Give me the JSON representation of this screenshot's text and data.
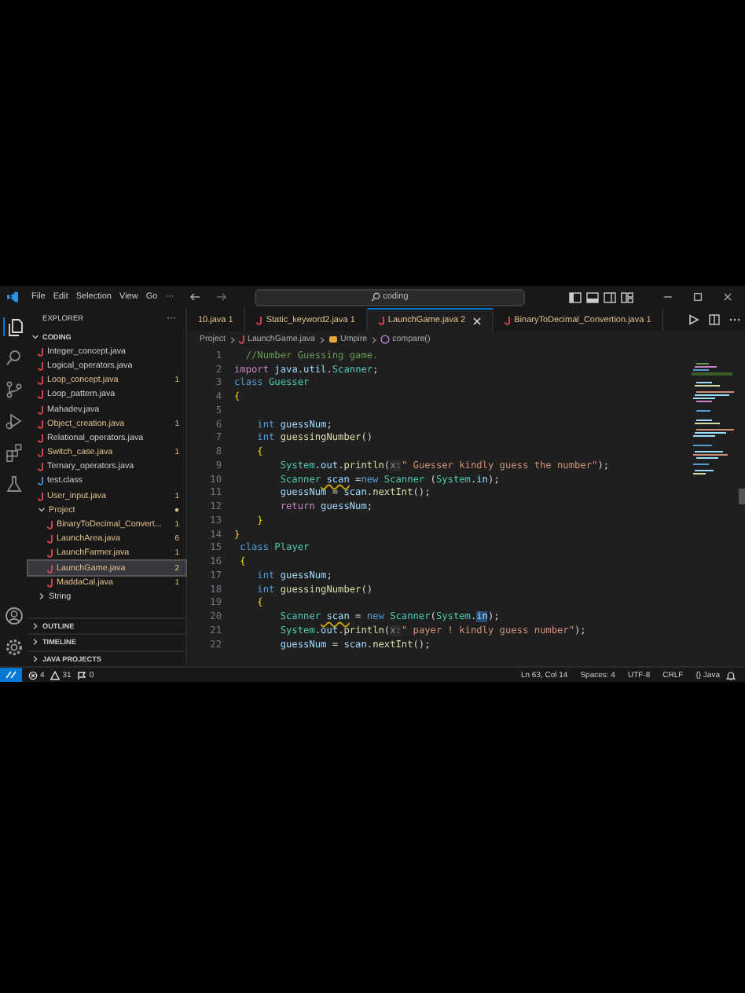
{
  "title_bar": {
    "menu": [
      "File",
      "Edit",
      "Selection",
      "View",
      "Go",
      "···"
    ],
    "search": "coding"
  },
  "activity_bar": {
    "top": [
      {
        "kind": "files",
        "selected": true
      },
      {
        "kind": "search",
        "selected": false
      },
      {
        "kind": "source-control",
        "selected": false
      },
      {
        "kind": "run",
        "selected": false
      },
      {
        "kind": "extensions",
        "selected": false
      },
      {
        "kind": "testing",
        "selected": false
      }
    ],
    "bottom": [
      {
        "kind": "account"
      },
      {
        "kind": "settings"
      }
    ]
  },
  "sidebar": {
    "title": "EXPLORER",
    "more": "···",
    "root": "CODING",
    "items": [
      {
        "kind": "file",
        "label": "Integer_concept.java",
        "modified": false,
        "selected": false
      },
      {
        "kind": "file",
        "label": "Logical_operators.java",
        "modified": false,
        "selected": false
      },
      {
        "kind": "file",
        "label": "Loop_concept.java",
        "badge": "1",
        "modified": true,
        "selected": false
      },
      {
        "kind": "file",
        "label": "Loop_pattern.java",
        "modified": false,
        "selected": false
      },
      {
        "kind": "file",
        "label": "Mahadev.java",
        "modified": false,
        "selected": false
      },
      {
        "kind": "file",
        "label": "Object_creation.java",
        "badge": "1",
        "modified": true,
        "selected": false
      },
      {
        "kind": "file",
        "label": "Relational_operators.java",
        "modified": false,
        "selected": false
      },
      {
        "kind": "file",
        "label": "Switch_case.java",
        "badge": "1",
        "modified": true,
        "selected": false
      },
      {
        "kind": "file",
        "label": "Ternary_operators.java",
        "modified": false,
        "selected": false
      },
      {
        "kind": "class",
        "label": "test.class",
        "modified": false,
        "selected": false
      },
      {
        "kind": "file",
        "label": "User_input.java",
        "badge": "1",
        "modified": true,
        "selected": false
      },
      {
        "kind": "folder",
        "label": "Project",
        "badge": "●",
        "modified": true,
        "selected": false,
        "expanded": true,
        "children": [
          {
            "kind": "file",
            "label": "BinaryToDecimal_Convert...",
            "badge": "1",
            "modified": true,
            "selected": false
          },
          {
            "kind": "file",
            "label": "LaunchArea.java",
            "badge": "6",
            "modified": true,
            "selected": false
          },
          {
            "kind": "file",
            "label": "LaunchFarmer.java",
            "badge": "1",
            "modified": true,
            "selected": false
          },
          {
            "kind": "file",
            "label": "LaunchGame.java",
            "badge": "2",
            "modified": true,
            "selected": true
          },
          {
            "kind": "file",
            "label": "MaddaCal.java",
            "badge": "1",
            "modified": true,
            "selected": false
          }
        ]
      },
      {
        "kind": "folder",
        "label": "String",
        "modified": false,
        "selected": false,
        "expanded": false
      }
    ],
    "panels": [
      "OUTLINE",
      "TIMELINE",
      "JAVA PROJECTS"
    ]
  },
  "tabs": [
    {
      "label": "10.java",
      "badge": "1",
      "selected": false
    },
    {
      "label": "Static_keyword2.java",
      "badge": "1",
      "selected": false
    },
    {
      "label": "LaunchGame.java",
      "badge": "2",
      "selected": true
    },
    {
      "label": "BinaryToDecimal_Convertion.java",
      "badge": "1",
      "selected": false
    }
  ],
  "breadcrumb": [
    {
      "kind": "folder",
      "label": "Project"
    },
    {
      "kind": "file",
      "label": "LaunchGame.java"
    },
    {
      "kind": "class",
      "label": "Umpire"
    },
    {
      "kind": "method",
      "label": "compare()"
    }
  ],
  "code": [
    {
      "num": "1",
      "tokens": [
        {
          "kind": "com",
          "text": "  //Number Guessing game."
        }
      ]
    },
    {
      "num": "2",
      "tokens": [
        {
          "kind": "ctl",
          "text": "import"
        },
        {
          "kind": "var",
          "text": " java"
        },
        {
          "kind": "p",
          "text": "."
        },
        {
          "kind": "var",
          "text": "util"
        },
        {
          "kind": "p",
          "text": "."
        },
        {
          "kind": "type",
          "text": "Scanner"
        },
        {
          "kind": "p",
          "text": ";"
        }
      ]
    },
    {
      "num": "3",
      "tokens": [
        {
          "kind": "kw",
          "text": "class"
        },
        {
          "kind": "type",
          "text": " Guesser"
        }
      ]
    },
    {
      "num": "4",
      "tokens": [
        {
          "kind": "br",
          "text": "{"
        }
      ]
    },
    {
      "num": "5"
    },
    {
      "num": "6",
      "tokens": [
        {
          "kind": "kw",
          "text": "    int"
        },
        {
          "kind": "var",
          "text": " guessNum"
        },
        {
          "kind": "p",
          "text": ";"
        }
      ]
    },
    {
      "num": "7",
      "tokens": [
        {
          "kind": "kw",
          "text": "    int"
        },
        {
          "kind": "fn",
          "text": " guessingNumber"
        },
        {
          "kind": "p",
          "text": "()"
        }
      ]
    },
    {
      "num": "8",
      "tokens": [
        {
          "kind": "br",
          "text": "    {"
        }
      ]
    },
    {
      "num": "9",
      "tokens": [
        {
          "kind": "type",
          "text": "        System"
        },
        {
          "kind": "p",
          "text": "."
        },
        {
          "kind": "var",
          "text": "out"
        },
        {
          "kind": "p",
          "text": "."
        },
        {
          "kind": "fn",
          "text": "println"
        },
        {
          "kind": "p",
          "text": "("
        },
        {
          "kind": "hint",
          "text": "x:"
        },
        {
          "kind": "str",
          "text": "\" Guesser kindly guess the number\""
        },
        {
          "kind": "p",
          "text": ");"
        }
      ]
    },
    {
      "num": "10",
      "tokens": [
        {
          "kind": "type",
          "text": "        Scanner"
        },
        {
          "kind": "warnvar",
          "text": " scan"
        },
        {
          "kind": "p",
          "text": " ="
        },
        {
          "kind": "kw",
          "text": "new"
        },
        {
          "kind": "type",
          "text": " Scanner"
        },
        {
          "kind": "p",
          "text": " ("
        },
        {
          "kind": "type",
          "text": "System"
        },
        {
          "kind": "p",
          "text": "."
        },
        {
          "kind": "var",
          "text": "in"
        },
        {
          "kind": "p",
          "text": ");"
        }
      ]
    },
    {
      "num": "11",
      "tokens": [
        {
          "kind": "var",
          "text": "        guessNum"
        },
        {
          "kind": "p",
          "text": " ="
        },
        {
          "kind": "var",
          "text": " scan"
        },
        {
          "kind": "p",
          "text": "."
        },
        {
          "kind": "fn",
          "text": "nextInt"
        },
        {
          "kind": "p",
          "text": "();"
        }
      ]
    },
    {
      "num": "12",
      "tokens": [
        {
          "kind": "ctl",
          "text": "        return"
        },
        {
          "kind": "var",
          "text": " guessNum"
        },
        {
          "kind": "p",
          "text": ";"
        }
      ]
    },
    {
      "num": "13",
      "tokens": [
        {
          "kind": "br",
          "text": "    }"
        }
      ]
    },
    {
      "num": "14",
      "tokens": [
        {
          "kind": "br",
          "text": "}"
        }
      ]
    },
    {
      "num": "15",
      "tokens": [
        {
          "kind": "kw",
          "text": " class"
        },
        {
          "kind": "type",
          "text": " Player"
        }
      ]
    },
    {
      "num": "16",
      "tokens": [
        {
          "kind": "br",
          "text": " {"
        }
      ]
    },
    {
      "num": "17",
      "tokens": [
        {
          "kind": "kw",
          "text": "    int"
        },
        {
          "kind": "var",
          "text": " guessNum"
        },
        {
          "kind": "p",
          "text": ";"
        }
      ]
    },
    {
      "num": "18",
      "tokens": [
        {
          "kind": "kw",
          "text": "    int"
        },
        {
          "kind": "fn",
          "text": " guessingNumber"
        },
        {
          "kind": "p",
          "text": "()"
        }
      ]
    },
    {
      "num": "19",
      "tokens": [
        {
          "kind": "br",
          "text": "    {"
        }
      ]
    },
    {
      "num": "20",
      "tokens": [
        {
          "kind": "type",
          "text": "        Scanner"
        },
        {
          "kind": "warnvar",
          "text": " scan"
        },
        {
          "kind": "p",
          "text": " ="
        },
        {
          "kind": "kw",
          "text": " new"
        },
        {
          "kind": "type",
          "text": " Scanner"
        },
        {
          "kind": "p",
          "text": "("
        },
        {
          "kind": "type",
          "text": "System"
        },
        {
          "kind": "p",
          "text": "."
        },
        {
          "kind": "hl",
          "text": "in"
        },
        {
          "kind": "p",
          "text": ");"
        }
      ]
    },
    {
      "num": "21",
      "tokens": [
        {
          "kind": "type",
          "text": "        System"
        },
        {
          "kind": "p",
          "text": "."
        },
        {
          "kind": "var",
          "text": "out"
        },
        {
          "kind": "p",
          "text": "."
        },
        {
          "kind": "fn",
          "text": "println"
        },
        {
          "kind": "p",
          "text": "("
        },
        {
          "kind": "hint",
          "text": "x:"
        },
        {
          "kind": "str",
          "text": "\" payer ! kindly guess number\""
        },
        {
          "kind": "p",
          "text": ");"
        }
      ]
    },
    {
      "num": "22",
      "tokens": [
        {
          "kind": "var",
          "text": "        guessNum"
        },
        {
          "kind": "p",
          "text": " ="
        },
        {
          "kind": "var",
          "text": " scan"
        },
        {
          "kind": "p",
          "text": "."
        },
        {
          "kind": "fn",
          "text": "nextInt"
        },
        {
          "kind": "p",
          "text": "();"
        }
      ]
    }
  ],
  "status_bar": {
    "left": [
      {
        "kind": "errors",
        "text": "4"
      },
      {
        "kind": "warnings",
        "text": "31"
      },
      {
        "kind": "ports",
        "text": "0"
      }
    ],
    "right": [
      "Ln 63, Col 14",
      "Spaces: 4",
      "UTF-8",
      "CRLF",
      "{} Java"
    ]
  }
}
